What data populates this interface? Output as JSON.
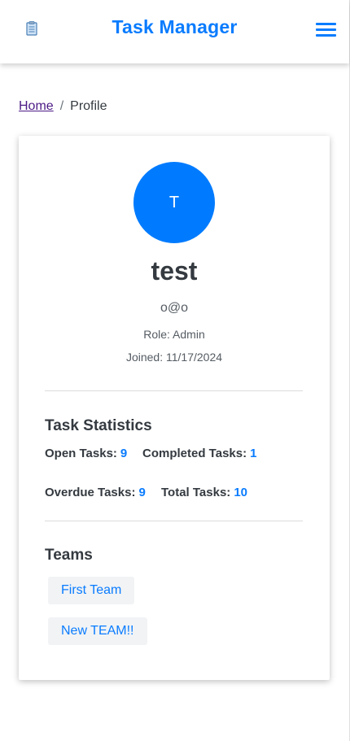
{
  "header": {
    "title": "Task Manager",
    "logo_icon": "clipboard-icon",
    "menu_icon": "hamburger-menu-icon",
    "accent_color": "#0a7cff"
  },
  "breadcrumb": {
    "home": "Home",
    "separator": "/",
    "current": "Profile"
  },
  "profile": {
    "avatar_initial": "T",
    "avatar_color": "#007bff",
    "username": "test",
    "email": "o@o",
    "role": "Role: Admin",
    "joined": "Joined: 11/17/2024"
  },
  "stats": {
    "title": "Task Statistics",
    "open_label": "Open Tasks:",
    "open_value": "9",
    "completed_label": "Completed Tasks:",
    "completed_value": "1",
    "overdue_label": "Overdue Tasks:",
    "overdue_value": "9",
    "total_label": "Total Tasks:",
    "total_value": "10"
  },
  "teams": {
    "title": "Teams",
    "items": [
      {
        "label": "First Team"
      },
      {
        "label": "New TEAM!!"
      }
    ]
  }
}
